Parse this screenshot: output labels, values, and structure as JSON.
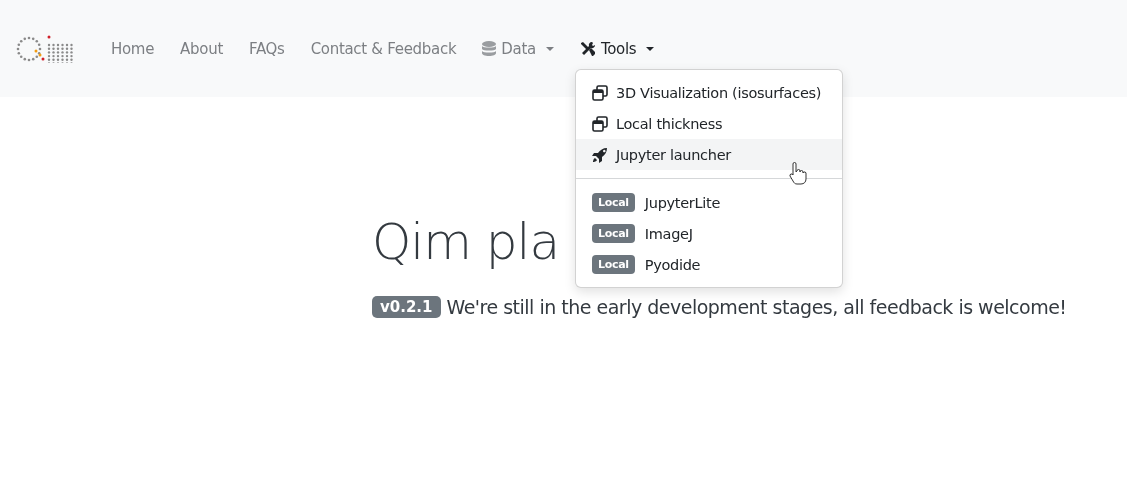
{
  "navbar": {
    "items": [
      {
        "label": "Home",
        "kind": "link",
        "selected": false
      },
      {
        "label": "About",
        "kind": "link",
        "selected": false
      },
      {
        "label": "FAQs",
        "kind": "link",
        "selected": false
      },
      {
        "label": "Contact & Feedback",
        "kind": "link",
        "selected": false
      },
      {
        "label": "Data",
        "kind": "database",
        "selected": false
      },
      {
        "label": "Tools",
        "kind": "tools",
        "selected": true
      }
    ]
  },
  "tools_menu": {
    "sections": [
      [
        {
          "label": "3D Visualization (isosurfaces)",
          "kind": "window",
          "highlighted": false
        },
        {
          "label": "Local thickness",
          "kind": "window",
          "highlighted": false
        },
        {
          "label": "Jupyter launcher",
          "kind": "rocket",
          "highlighted": true
        }
      ],
      [
        {
          "label": "JupyterLite",
          "badge": "Local",
          "highlighted": false
        },
        {
          "label": "ImageJ",
          "badge": "Local",
          "highlighted": false
        },
        {
          "label": "Pyodide",
          "badge": "Local",
          "highlighted": false
        }
      ]
    ]
  },
  "hero": {
    "title": "Qim pla",
    "version": "v0.2.1",
    "subtitle": "We're still in the early development stages, all feedback is welcome!"
  }
}
